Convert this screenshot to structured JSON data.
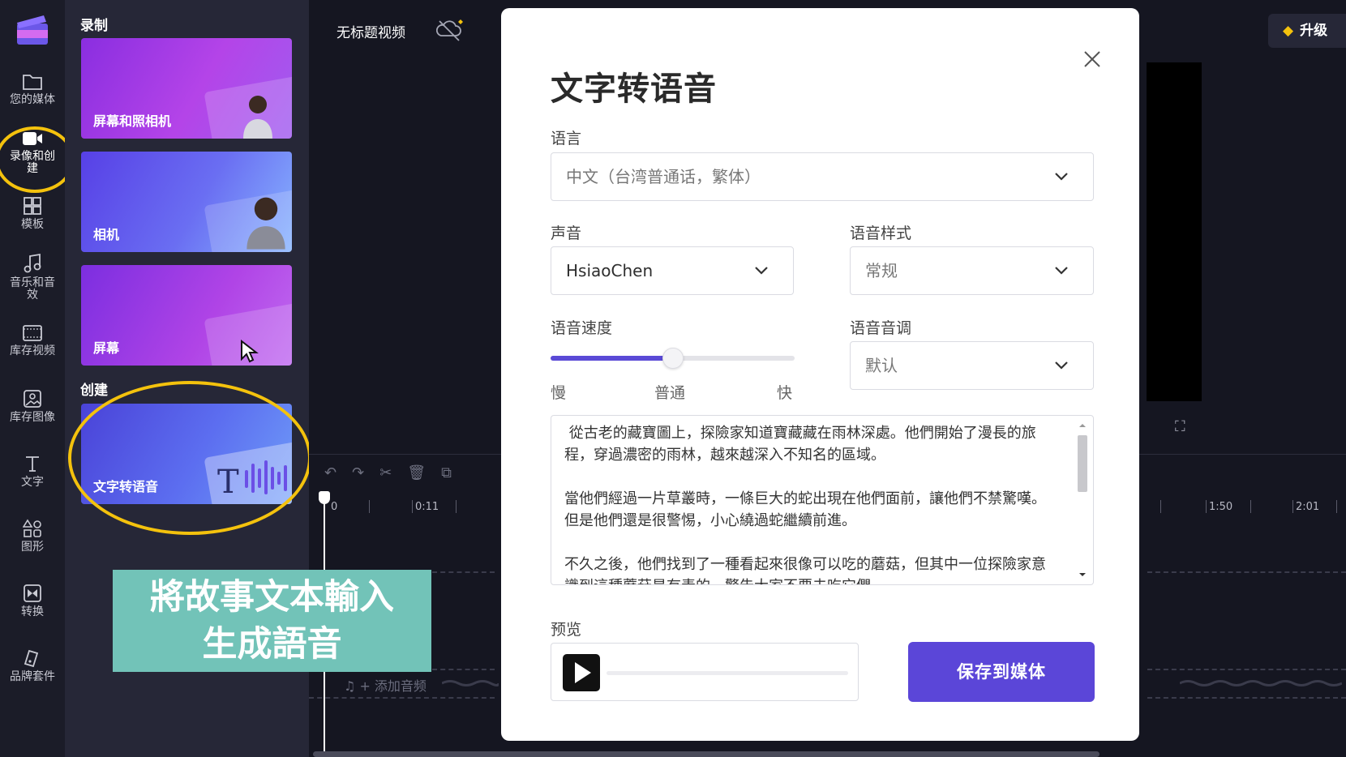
{
  "rail": {
    "items": [
      {
        "label": "您的媒体",
        "icon": "folder-icon"
      },
      {
        "label": "录像和创建",
        "icon": "video-camera-icon"
      },
      {
        "label": "模板",
        "icon": "templates-icon"
      },
      {
        "label": "音乐和音效",
        "icon": "music-note-icon"
      },
      {
        "label": "库存视频",
        "icon": "film-icon"
      },
      {
        "label": "库存图像",
        "icon": "image-icon"
      },
      {
        "label": "文字",
        "icon": "text-icon"
      },
      {
        "label": "图形",
        "icon": "shapes-icon"
      },
      {
        "label": "转换",
        "icon": "transition-icon"
      },
      {
        "label": "品牌套件",
        "icon": "brand-kit-icon"
      }
    ]
  },
  "panel": {
    "record_title": "录制",
    "create_title": "创建",
    "cards": [
      {
        "label": "屏幕和照相机"
      },
      {
        "label": "相机"
      },
      {
        "label": "屏幕"
      },
      {
        "label": "文字转语音"
      }
    ]
  },
  "editor": {
    "video_title": "无标题视频",
    "upgrade_label": "升级",
    "ruler": [
      "0",
      "0:11",
      "1:50",
      "2:01"
    ],
    "add_audio": "+ 添加音频"
  },
  "caption": {
    "line1": "將故事文本輸入",
    "line2": "生成語音"
  },
  "modal": {
    "title": "文字转语音",
    "language_label": "语言",
    "language_value": "中文（台湾普通话，繁体）",
    "voice_label": "声音",
    "voice_value": "HsiaoChen",
    "style_label": "语音样式",
    "style_value": "常规",
    "speed_label": "语音速度",
    "speed_value": 0.5,
    "speed_slow": "慢",
    "speed_normal": "普通",
    "speed_fast": "快",
    "pitch_label": "语音音调",
    "pitch_value": "默认",
    "text": " 從古老的藏寶圖上，探險家知道寶藏藏在雨林深處。他們開始了漫長的旅程，穿過濃密的雨林，越來越深入不知名的區域。\n\n當他們經過一片草叢時，一條巨大的蛇出現在他們面前，讓他們不禁驚嘆。但是他們還是很警惕，小心繞過蛇繼續前進。\n\n不久之後，他們找到了一種看起來很像可以吃的蘑菇，但其中一位探險家意識到這種蘑菇是有毒的，警告大家不要去吃它們。",
    "preview_label": "预览",
    "preview_progress": 0,
    "save_label": "保存到媒体"
  }
}
